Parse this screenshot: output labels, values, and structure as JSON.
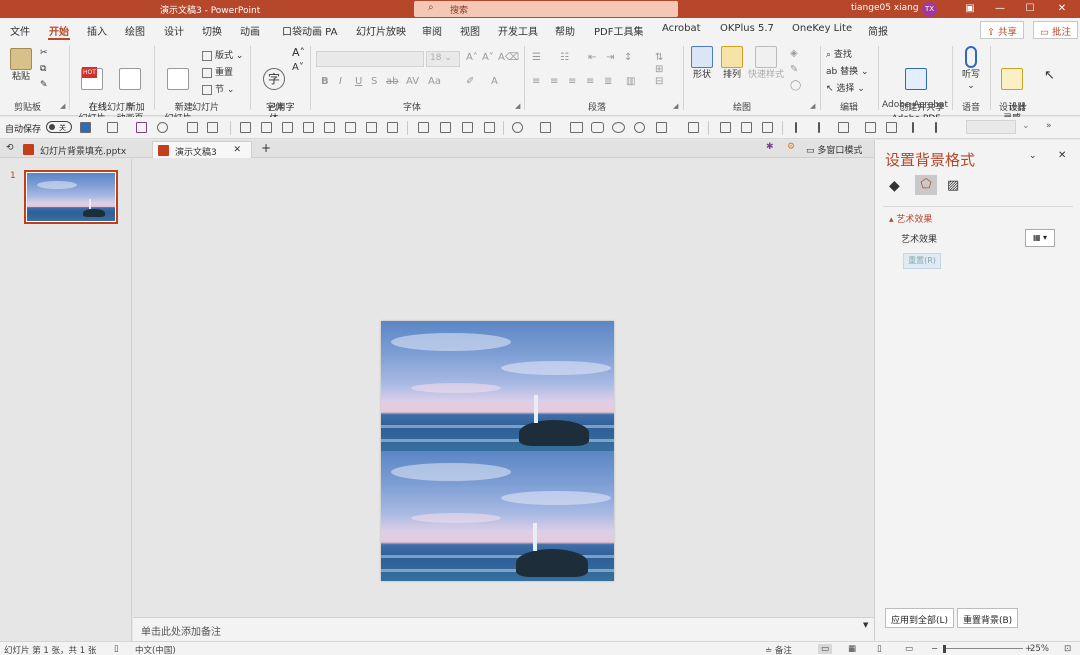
{
  "titlebar": {
    "title": "演示文稿3  -  PowerPoint",
    "search_placeholder": "搜索",
    "user": "tiange05 xiang",
    "avatar_initials": "TX",
    "accent_color": "#b7472a"
  },
  "menu": {
    "tabs": [
      "文件",
      "开始",
      "插入",
      "绘图",
      "设计",
      "切换",
      "动画",
      "口袋动画 PA",
      "幻灯片放映",
      "审阅",
      "视图",
      "开发工具",
      "帮助",
      "PDF工具集",
      "Acrobat",
      "OKPlus 5.7",
      "OneKey Lite",
      "简报"
    ],
    "active_tab": "开始",
    "share_label": "共享",
    "comment_label": "批注"
  },
  "ribbon": {
    "clipboard": {
      "paste": "粘贴",
      "group": "剪贴板"
    },
    "online_slides": {
      "online": "在线\n幻灯片",
      "new_anim": "新加\n动画页",
      "group": "在线幻灯片",
      "hot": "HOT"
    },
    "slides": {
      "new_slide": "新建\n幻灯片",
      "layout": "版式",
      "reset": "重置",
      "section": "节",
      "group": "幻灯片"
    },
    "fonts_group": {
      "used_font": "已用字\n体",
      "group": "字体"
    },
    "font": {
      "size": "18",
      "group": "字体"
    },
    "paragraph": {
      "group": "段落"
    },
    "drawing": {
      "shape": "形状",
      "arrange": "排列",
      "quick_style": "快速样式",
      "group": "绘图"
    },
    "editing": {
      "find": "查找",
      "replace": "替换",
      "select": "选择",
      "group": "编辑"
    },
    "acrobat": {
      "create": "创建并共享\nAdobe PDF",
      "group": "Adobe Acrobat"
    },
    "voice": {
      "dictate": "听写",
      "group": "语音"
    },
    "designer": {
      "ideas": "设计\n灵感",
      "group": "设计器"
    }
  },
  "qat": {
    "autosave_label": "自动保存",
    "autosave_state": "关"
  },
  "doc_tabs": {
    "tabs": [
      "幻灯片背景填充.pptx",
      "演示文稿3"
    ],
    "active": "演示文稿3",
    "multi_window": "多窗口模式"
  },
  "thumbnails": {
    "slide_number": "1"
  },
  "notes": {
    "placeholder": "单击此处添加备注"
  },
  "format_pane": {
    "title": "设置背景格式",
    "section": "艺术效果",
    "row_label": "艺术效果",
    "reset_label": "重置(R)",
    "apply_all": "应用到全部(L)",
    "reset_bg": "重置背景(B)"
  },
  "statusbar": {
    "slide_info": "幻灯片 第 1 张，共 1 张",
    "language": "中文(中国)",
    "notes_label": "备注",
    "zoom": "25%"
  }
}
